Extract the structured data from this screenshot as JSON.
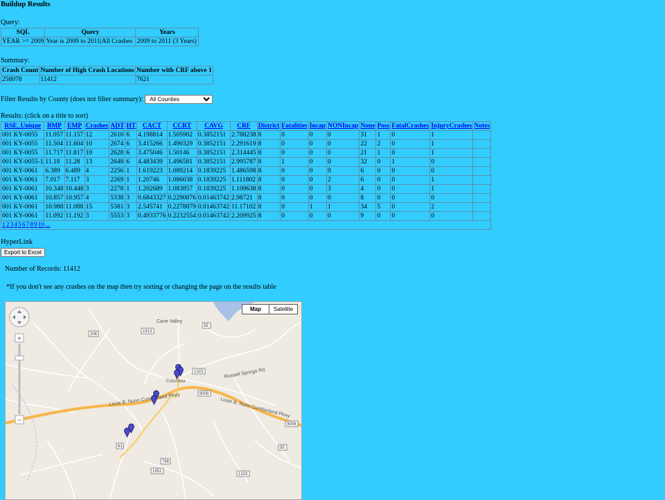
{
  "page_title": "Buildup Results",
  "query": {
    "label": "Query:",
    "headers": [
      "SQL",
      "Query",
      "Years"
    ],
    "row": [
      "YEAR >= 2009",
      "Year is 2009 to 2011|All Crashes",
      "2009 to 2011 (3 Years)"
    ]
  },
  "summary": {
    "label": "Summary:",
    "headers": [
      "Crash Count",
      "Number of High Crash Locations",
      "Number with CRF above 1"
    ],
    "row": [
      "258078",
      "11412",
      "7621"
    ]
  },
  "filter": {
    "label": "Filter Results by County (does not filter summary):",
    "selected": "All Counties"
  },
  "results": {
    "label": "Results: (click on a title to sort)",
    "headers": [
      "RSE_Unique",
      "BMP",
      "EMP",
      "Crashes",
      "ADT",
      "HT",
      "CACT",
      "CCRT",
      "CAVG",
      "CRF",
      "District",
      "Fatalities",
      "Incap",
      "NONIncap",
      "None",
      "Poss",
      "FatalCrashes",
      "InjuryCrashes",
      "Notes"
    ],
    "rows": [
      [
        "001 KY-0055",
        "11.057",
        "11.157",
        "12",
        "2610",
        "6",
        "4.198814",
        "1.505902",
        "0.3852151",
        "2.788238",
        "8",
        "0",
        "0",
        "0",
        "31",
        "1",
        "0",
        "1",
        ""
      ],
      [
        "001 KY-0055",
        "11.504",
        "11.604",
        "10",
        "2674",
        "6",
        "3.415266",
        "1.490329",
        "0.3852151",
        "2.291619",
        "8",
        "0",
        "0",
        "0",
        "22",
        "2",
        "0",
        "1",
        ""
      ],
      [
        "001 KY-0055",
        "11.717",
        "11.817",
        "10",
        "2628",
        "6",
        "3.475046",
        "1.50146",
        "0.3852151",
        "2.314445",
        "8",
        "0",
        "0",
        "0",
        "21",
        "1",
        "0",
        "1",
        ""
      ],
      [
        "001 KY-0055-1",
        "11.18",
        "11.28",
        "13",
        "2648",
        "6",
        "4.483439",
        "1.496581",
        "0.3852151",
        "2.995787",
        "8",
        "1",
        "0",
        "0",
        "32",
        "0",
        "1",
        "0",
        ""
      ],
      [
        "001 KY-0061",
        "6.389",
        "6.489",
        "4",
        "2256",
        "1",
        "1.619223",
        "1.089214",
        "0.1839225",
        "1.486598",
        "8",
        "0",
        "0",
        "0",
        "6",
        "0",
        "0",
        "0",
        ""
      ],
      [
        "001 KY-0061",
        "7.017",
        "7.117",
        "3",
        "2269",
        "1",
        "1.20746",
        "1.086038",
        "0.1839225",
        "1.111802",
        "8",
        "0",
        "0",
        "2",
        "6",
        "0",
        "0",
        "1",
        ""
      ],
      [
        "001 KY-0061",
        "10.348",
        "10.448",
        "3",
        "2278",
        "1",
        "1.202689",
        "1.083857",
        "0.1839225",
        "1.109638",
        "8",
        "0",
        "0",
        "3",
        "4",
        "0",
        "0",
        "1",
        ""
      ],
      [
        "001 KY-0061",
        "10.857",
        "10.957",
        "4",
        "5338",
        "3",
        "0.6843327",
        "0.2290876",
        "0.01463742",
        "2.98721",
        "8",
        "0",
        "0",
        "0",
        "8",
        "0",
        "0",
        "0",
        ""
      ],
      [
        "001 KY-0061",
        "10.988",
        "11.088",
        "15",
        "5381",
        "3",
        "2.545741",
        "0.2278879",
        "0.01463742",
        "11.17102",
        "8",
        "0",
        "1",
        "1",
        "34",
        "5",
        "0",
        "2",
        ""
      ],
      [
        "001 KY-0061",
        "11.092",
        "11.192",
        "3",
        "5553",
        "3",
        "0.4933776",
        "0.2232554",
        "0.01463742",
        "2.209925",
        "8",
        "0",
        "0",
        "0",
        "9",
        "0",
        "0",
        "0",
        ""
      ]
    ],
    "pages": [
      "1",
      "2",
      "3",
      "4",
      "5",
      "6",
      "7",
      "8",
      "9",
      "10",
      "..."
    ]
  },
  "hyperlink_label": "HyperLink",
  "export_label": "Export to Excel",
  "records_text": "Number of Records: 11412",
  "note_text": "*If you don't see any crashes on the map then try sorting or changing the page on the results table",
  "map": {
    "type_map": "Map",
    "type_satellite": "Satellite",
    "places": [
      "Cane Valley",
      "Columbia",
      "Louie B. Nunn Cumberland Pkwy",
      "Russell Springs Rd",
      "Louie B. Nunn Cumberland Pkwy"
    ],
    "route_numbers": [
      "55",
      "206",
      "1913",
      "1323",
      "9008",
      "61",
      "768",
      "1952",
      "1323",
      "9008",
      "55"
    ],
    "colors": {
      "road_major": "#f7b64a",
      "road_minor": "#ffffff",
      "marker": "#4a4ac8",
      "water": "#a7c1e8"
    }
  }
}
